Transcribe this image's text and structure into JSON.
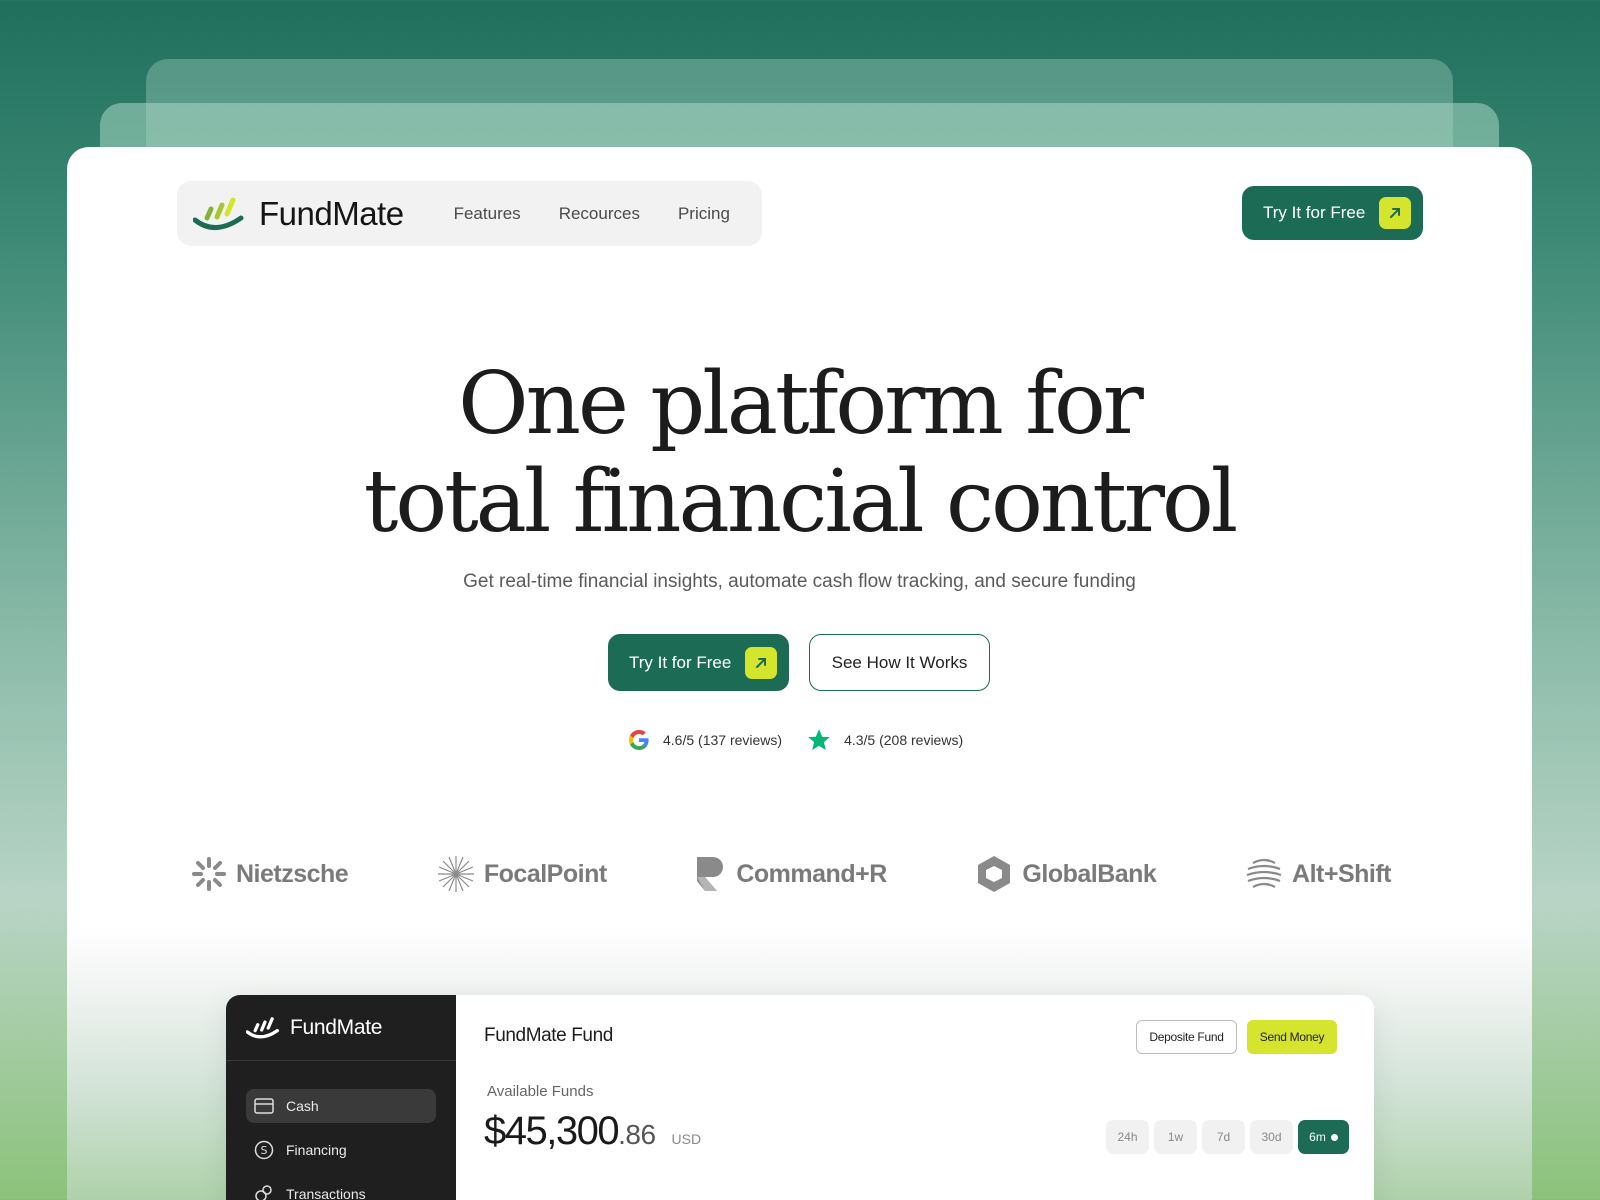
{
  "brand": {
    "name": "FundMate",
    "accent": "#1b6b55",
    "lime": "#d5e42d"
  },
  "nav": {
    "links": [
      "Features",
      "Recources",
      "Pricing"
    ],
    "cta": "Try It for Free"
  },
  "hero": {
    "title_line1": "One platform for",
    "title_line2": "total financial control",
    "subtitle": "Get real-time financial insights, automate cash flow tracking, and secure funding",
    "primary_cta": "Try It for Free",
    "secondary_cta": "See How It Works"
  },
  "reviews": [
    {
      "icon": "google-icon",
      "text": "4.6/5 (137 reviews)"
    },
    {
      "icon": "star-icon",
      "text": "4.3/5 (208 reviews)"
    }
  ],
  "partners": [
    "Nietzsche",
    "FocalPoint",
    "Command+R",
    "GlobalBank",
    "Alt+Shift"
  ],
  "dashboard": {
    "logo": "FundMate",
    "menu": [
      "Cash",
      "Financing",
      "Transactions"
    ],
    "title": "FundMate Fund",
    "deposit_label": "Deposite Fund",
    "send_label": "Send Money",
    "funds_label": "Available Funds",
    "funds_main": "$45,300",
    "funds_cents": ".86",
    "currency": "USD",
    "ranges": [
      "24h",
      "1w",
      "7d",
      "30d",
      "6m"
    ],
    "active_range": "6m"
  }
}
